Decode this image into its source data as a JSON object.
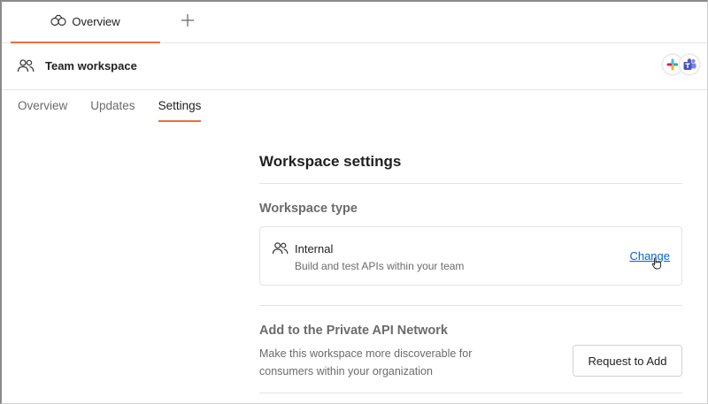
{
  "tabs": [
    {
      "label": "Overview",
      "icon": "collection-overview-icon"
    }
  ],
  "new_tab_icon": "plus-icon",
  "workspace": {
    "icon": "team-icon",
    "title": "Team workspace",
    "integrations": [
      "slack-icon",
      "microsoft-teams-icon"
    ]
  },
  "subtabs": [
    {
      "label": "Overview",
      "active": false
    },
    {
      "label": "Updates",
      "active": false
    },
    {
      "label": "Settings",
      "active": true
    }
  ],
  "settings": {
    "title": "Workspace settings",
    "workspace_type": {
      "heading": "Workspace type",
      "type_label": "Internal",
      "type_description": "Build and test APIs within your team",
      "change_label": "Change"
    },
    "private_network": {
      "heading": "Add to the Private API Network",
      "description": "Make this workspace more discoverable for consumers within your organization",
      "button_label": "Request to Add"
    }
  },
  "colors": {
    "accent": "#ea6e39",
    "link": "#0265d2",
    "muted_text": "#6b6b6b"
  }
}
